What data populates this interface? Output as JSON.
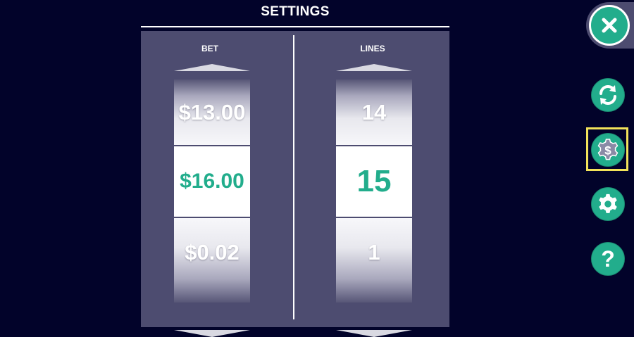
{
  "header": {
    "title": "SETTINGS"
  },
  "bet": {
    "label": "BET",
    "above": "$13.00",
    "selected": "$16.00",
    "below": "$0.02"
  },
  "lines": {
    "label": "LINES",
    "above": "14",
    "selected": "15",
    "below": "1"
  },
  "sidebar": {
    "buttons": [
      {
        "icon": "close-icon"
      },
      {
        "icon": "refresh-icon"
      },
      {
        "icon": "bet-settings-icon",
        "highlighted": true
      },
      {
        "icon": "gear-icon"
      },
      {
        "icon": "help-icon"
      }
    ]
  },
  "colors": {
    "background": "#02032a",
    "panel": "#4d4c70",
    "accent": "#22ad8c",
    "highlight": "#f2e35a"
  }
}
